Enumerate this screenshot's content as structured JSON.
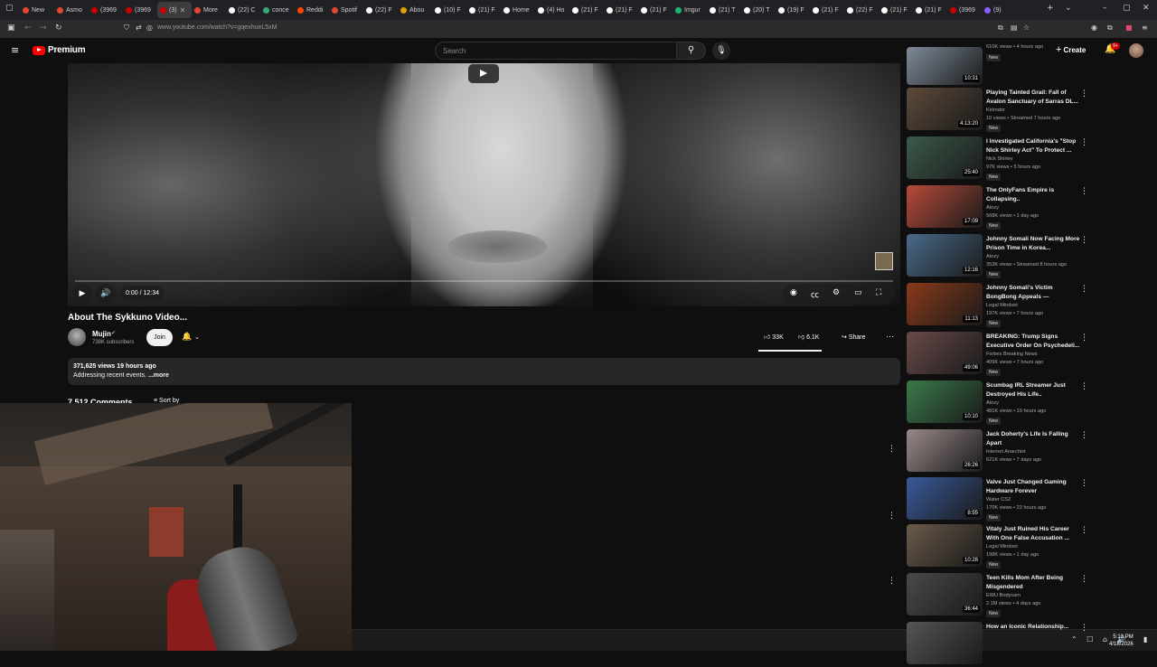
{
  "browser": {
    "tabs": [
      {
        "label": "New",
        "color": "#e4472e"
      },
      {
        "label": "Asmo",
        "color": "#e4472e"
      },
      {
        "label": "(3969",
        "color": "#cc0000"
      },
      {
        "label": "(3969",
        "color": "#cc0000"
      },
      {
        "label": "(3)",
        "color": "#cc0000",
        "active": true
      },
      {
        "label": "More",
        "color": "#e4472e"
      },
      {
        "label": "(22) C",
        "color": "#ffffff"
      },
      {
        "label": "conce",
        "color": "#3aa776"
      },
      {
        "label": "Reddi",
        "color": "#ff4500"
      },
      {
        "label": "Spotif",
        "color": "#e4472e"
      },
      {
        "label": "(22) F",
        "color": "#ffffff"
      },
      {
        "label": "Abou",
        "color": "#d9a400"
      },
      {
        "label": "(10) F",
        "color": "#ffffff"
      },
      {
        "label": "(21) F",
        "color": "#ffffff"
      },
      {
        "label": "Home",
        "color": "#ffffff"
      },
      {
        "label": "(4) Ho",
        "color": "#ffffff"
      },
      {
        "label": "(21) F",
        "color": "#ffffff"
      },
      {
        "label": "(21) F",
        "color": "#ffffff"
      },
      {
        "label": "(21) F",
        "color": "#ffffff"
      },
      {
        "label": "Imgur",
        "color": "#1bb76e"
      },
      {
        "label": "(21) T",
        "color": "#ffffff"
      },
      {
        "label": "(20) T",
        "color": "#ffffff"
      },
      {
        "label": "(19) F",
        "color": "#ffffff"
      },
      {
        "label": "(21) F",
        "color": "#ffffff"
      },
      {
        "label": "(22) F",
        "color": "#ffffff"
      },
      {
        "label": "(21) F",
        "color": "#ffffff"
      },
      {
        "label": "(21) F",
        "color": "#ffffff"
      },
      {
        "label": "(3969",
        "color": "#cc0000"
      },
      {
        "label": "(9)",
        "color": "#8a5cff"
      }
    ],
    "url": "www.youtube.com/watch?v=gqexhueL5xM"
  },
  "masthead": {
    "logo_text": "Premium",
    "search_placeholder": "Search",
    "create_label": "Create",
    "notif_count": "9+"
  },
  "player": {
    "time": "0:00 / 12:34"
  },
  "video": {
    "title": "About The Sykkuno Video...",
    "channel": "Mujin",
    "subscribers": "738K subscribers",
    "join_label": "Join",
    "likes": "33K",
    "dislikes": "6.1K",
    "share_label": "Share",
    "views_meta": "371,625 views  19 hours ago",
    "description": "Addressing recent events.",
    "more_label": " ...more",
    "comments_count": "7,512 Comments",
    "sort_label": "Sort by"
  },
  "taskbar": {
    "time": "5:13 PM",
    "date": "4/18/2026"
  },
  "sidebar": [
    {
      "title": "",
      "channel": "",
      "views": "610K views • 4 hours ago",
      "new": "New",
      "duration": "10:31",
      "thumb": "#7e8b9a"
    },
    {
      "title": "Playing Tainted Grail: Fall of Avalon Sanctuary of Sarras DL...",
      "channel": "Kirimdor",
      "views": "10 views • Streamed 7 hours ago",
      "new": "New",
      "duration": "4:13:20",
      "thumb": "#5d4a3a"
    },
    {
      "title": "I Investigated California's \"Stop Nick Shirley Act\" To Protect ...",
      "channel": "Nick Shirley",
      "views": "97K views • 5 hours ago",
      "new": "New",
      "duration": "25:40",
      "thumb": "#3c5a4a"
    },
    {
      "title": "The OnlyFans Empire is Collapsing..",
      "channel": "Atozy",
      "views": "568K views • 1 day ago",
      "new": "New",
      "duration": "17:09",
      "thumb": "#b84a3a"
    },
    {
      "title": "Johnny Somali Now Facing More Prison Time in Korea...",
      "channel": "Atozy",
      "views": "353K views • Streamed 8 hours ago",
      "new": "New",
      "duration": "12:16",
      "thumb": "#4a6a8a"
    },
    {
      "title": "Johnny Somali's Victim BongBong Appeals — DOUBLE...",
      "channel": "Legal Mindset",
      "views": "197K views • 7 hours ago",
      "new": "New",
      "duration": "11:13",
      "thumb": "#8a3a1a"
    },
    {
      "title": "BREAKING: Trump Signs Executive Order On Psychedeli...",
      "channel": "Forbes Breaking News",
      "views": "409K views • 7 hours ago",
      "new": "New",
      "duration": "49:06",
      "thumb": "#6a4a4a"
    },
    {
      "title": "Scumbag IRL Streamer Just Destroyed His Life..",
      "channel": "Atozy",
      "views": "481K views • 19 hours ago",
      "new": "New",
      "duration": "10:10",
      "thumb": "#3a7a4a"
    },
    {
      "title": "Jack Doherty's Life Is Falling Apart",
      "channel": "Internet Anarchist",
      "views": "621K views • 7 days ago",
      "new": "",
      "duration": "26:26",
      "thumb": "#9a8a8a"
    },
    {
      "title": "Valve Just Changed Gaming Hardware Forever",
      "channel": "Water CS2",
      "views": "170K views • 23 hours ago",
      "new": "New",
      "duration": "8:55",
      "thumb": "#3a5a9a"
    },
    {
      "title": "Vitaly Just Ruined His Career With One False Accusation ...",
      "channel": "Legal Mindset",
      "views": "198K views • 1 day ago",
      "new": "New",
      "duration": "10:28",
      "thumb": "#6a5a4a"
    },
    {
      "title": "Teen Kills Mom After Being Misgendered",
      "channel": "EWU Bodycam",
      "views": "2.1M views • 4 days ago",
      "new": "New",
      "duration": "36:44",
      "thumb": "#4a4a4a"
    },
    {
      "title": "How an Iconic Relationship...",
      "channel": "",
      "views": "",
      "new": "",
      "duration": "",
      "thumb": "#555555"
    }
  ]
}
